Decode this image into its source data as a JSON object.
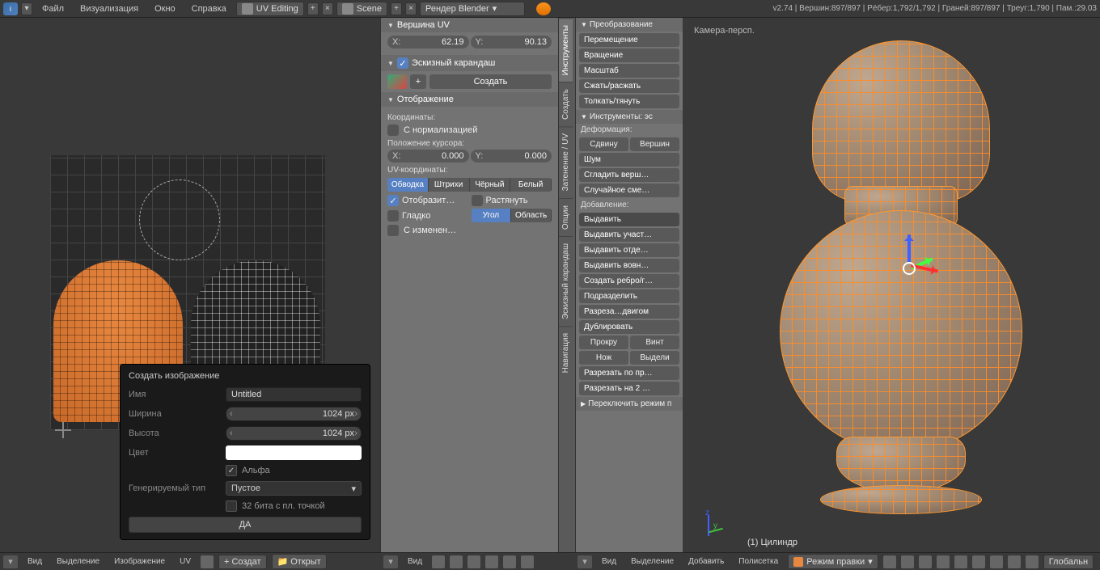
{
  "topbar": {
    "menus": [
      "Файл",
      "Визуализация",
      "Окно",
      "Справка"
    ],
    "layout": "UV Editing",
    "scene": "Scene",
    "engine": "Рендер Blender",
    "stats": "v2.74 | Вершин:897/897 | Рёбер:1,792/1,792 | Граней:897/897 | Треуг:1,790 | Пам.:29.03"
  },
  "npanel": {
    "uvvertex": {
      "title": "Вершина UV",
      "x_label": "X:",
      "x": "62.19",
      "y_label": "Y:",
      "y": "90.13"
    },
    "gp": {
      "title": "Эскизный карандаш",
      "create": "Создать"
    },
    "display": {
      "title": "Отображение",
      "coords_label": "Координаты:",
      "normalized": "С нормализацией",
      "cursor_label": "Положение курсора:",
      "cx_label": "X:",
      "cx": "0.000",
      "cy_label": "Y:",
      "cy": "0.000",
      "uvc_label": "UV-координаты:",
      "seg": [
        "Обводка",
        "Штрихи",
        "Чёрный",
        "Белый"
      ],
      "show": "Отобразит…",
      "stretch": "Растянуть",
      "smooth": "Гладко",
      "angle": "Угол",
      "area": "Область",
      "modified": "С изменен…"
    }
  },
  "vtabs": [
    "Инструменты",
    "Создать",
    "Затенение / UV",
    "Опции",
    "Эскизный карандаш",
    "Навигация"
  ],
  "tpanel": {
    "transform_hdr": "Преобразование",
    "transform": [
      "Перемещение",
      "Вращение",
      "Масштаб",
      "Сжать/расжать",
      "Толкать/тянуть"
    ],
    "meshtools_hdr": "Инструменты: эс",
    "deform_label": "Деформация:",
    "deform_row1": [
      "Сдвину",
      "Вершин"
    ],
    "noise": "Шум",
    "smooth_v": "Сгладить верш…",
    "random": "Случайное сме…",
    "add_label": "Добавление:",
    "add": [
      "Выдавить",
      "Выдавить участ…",
      "Выдавить отде…",
      "Выдавить вовн…",
      "Создать ребро/г…",
      "Подразделить",
      "Разреза…двигом",
      "Дублировать"
    ],
    "add_row": [
      "Прокру",
      "Винт"
    ],
    "add_row2": [
      "Нож",
      "Выдели"
    ],
    "add_tail": [
      "Разрезать по пр…",
      "Разрезать на 2 …"
    ],
    "collapse": "Переключить режим п"
  },
  "popup": {
    "title": "Создать изображение",
    "name_label": "Имя",
    "name": "Untitled",
    "width_label": "Ширина",
    "width": "1024 px",
    "height_label": "Высота",
    "height": "1024 px",
    "color_label": "Цвет",
    "alpha": "Альфа",
    "gentype_label": "Генерируемый тип",
    "gentype": "Пустое",
    "float32": "32 бита с пл. точкой",
    "ok": "ДА"
  },
  "uvheader": {
    "menus": [
      "Вид",
      "Выделение",
      "Изображение",
      "UV"
    ],
    "new": "Создат",
    "open": "Открыт"
  },
  "midheader": {
    "view": "Вид"
  },
  "view3d": {
    "camera": "Камера-персп.",
    "object": "(1) Цилиндр"
  },
  "v3header": {
    "menus": [
      "Вид",
      "Выделение",
      "Добавить",
      "Полисетка"
    ],
    "mode": "Режим правки",
    "orient": "Глобальн"
  }
}
